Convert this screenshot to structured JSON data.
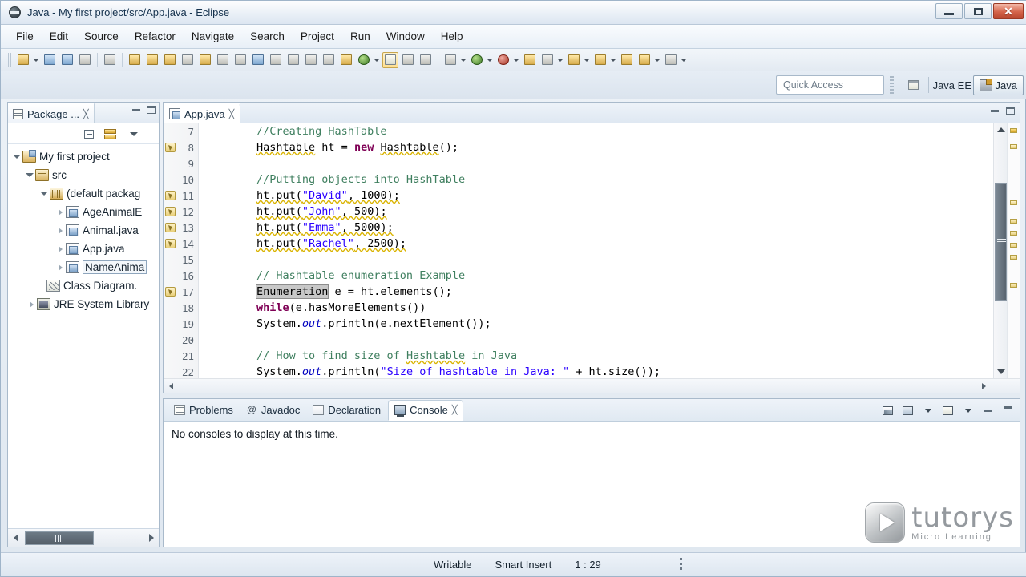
{
  "window": {
    "title": "Java - My first project/src/App.java - Eclipse",
    "app_icon": "eclipse-icon",
    "controls": [
      {
        "name": "minimize-button",
        "glyph": ""
      },
      {
        "name": "maximize-button",
        "glyph": ""
      },
      {
        "name": "close-button",
        "glyph": "✕"
      }
    ]
  },
  "menubar": {
    "items": [
      "File",
      "Edit",
      "Source",
      "Refactor",
      "Navigate",
      "Search",
      "Project",
      "Run",
      "Window",
      "Help"
    ]
  },
  "toolbar": {
    "icons": [
      "new-wizard-icon",
      "new-wizard-dropdown",
      "save-icon",
      "save-all-icon",
      "print-icon",
      "toggle-mark-occurrences-icon",
      "open-type-icon",
      "new-java-project-icon",
      "new-package-icon",
      "external-tools-icon",
      "search-icon",
      "last-edit-location-icon",
      "next-annotation-icon",
      "previous-annotation-icon",
      "back-icon",
      "forward-icon",
      "debug-icon",
      "run-icon",
      "coverage-icon",
      "open-perspective-icon",
      "refresh-icon",
      "toggle-breadcrumb-icon"
    ]
  },
  "quick_access": {
    "placeholder": "Quick Access",
    "new_perspective_icon": "open-perspective-icon",
    "perspectives": [
      {
        "label": "Java EE",
        "active": false
      },
      {
        "label": "Java",
        "active": true
      }
    ]
  },
  "package_explorer": {
    "tab_label": "Package ...",
    "tab_icon": "package-explorer-icon",
    "close_glyph": "╳",
    "toolbar_icons": [
      "collapse-all-icon",
      "link-with-editor-icon",
      "view-menu-icon"
    ],
    "view_buttons": [
      "minimize-view-button",
      "maximize-view-button"
    ],
    "tree": [
      {
        "label": "My first project",
        "indent": 0,
        "icon": "java-project-icon",
        "twisty": "open",
        "selected": false
      },
      {
        "label": "src",
        "indent": 1,
        "icon": "source-folder-icon",
        "twisty": "open",
        "selected": false
      },
      {
        "label": "(default packag",
        "indent": 2,
        "icon": "package-icon",
        "twisty": "open",
        "selected": false
      },
      {
        "label": "AgeAnimalE",
        "indent": 3,
        "icon": "java-file-icon",
        "twisty": "closed",
        "selected": false
      },
      {
        "label": "Animal.java",
        "indent": 3,
        "icon": "java-file-icon",
        "twisty": "closed",
        "selected": false
      },
      {
        "label": "App.java",
        "indent": 3,
        "icon": "java-file-icon",
        "twisty": "closed",
        "selected": false
      },
      {
        "label": "NameAnima",
        "indent": 3,
        "icon": "java-file-icon",
        "twisty": "closed",
        "selected": true
      },
      {
        "label": "Class Diagram.",
        "indent": 2,
        "icon": "class-diagram-icon",
        "twisty": "none",
        "selected": false
      },
      {
        "label": "JRE System Library",
        "indent": 1,
        "icon": "jre-library-icon",
        "twisty": "closed",
        "selected": false
      }
    ]
  },
  "editor": {
    "tab_label": "App.java",
    "tab_icon": "java-file-icon",
    "close_glyph": "╳",
    "view_buttons": [
      "minimize-editor-button",
      "maximize-editor-button"
    ],
    "first_line_number": 7,
    "lines": [
      {
        "num": 7,
        "warning": false,
        "text": "//Creating HashTable"
      },
      {
        "num": 8,
        "warning": true,
        "text": "Hashtable ht = new Hashtable();"
      },
      {
        "num": 9,
        "warning": false,
        "text": ""
      },
      {
        "num": 10,
        "warning": false,
        "text": "//Putting objects into HashTable"
      },
      {
        "num": 11,
        "warning": true,
        "text": "ht.put(\"David\", 1000);"
      },
      {
        "num": 12,
        "warning": true,
        "text": "ht.put(\"John\", 500);"
      },
      {
        "num": 13,
        "warning": true,
        "text": "ht.put(\"Emma\", 5000);"
      },
      {
        "num": 14,
        "warning": true,
        "text": "ht.put(\"Rachel\", 2500);"
      },
      {
        "num": 15,
        "warning": false,
        "text": ""
      },
      {
        "num": 16,
        "warning": false,
        "text": "// Hashtable enumeration Example"
      },
      {
        "num": 17,
        "warning": true,
        "text": "Enumeration e = ht.elements();"
      },
      {
        "num": 18,
        "warning": false,
        "text": "while(e.hasMoreElements())"
      },
      {
        "num": 19,
        "warning": false,
        "text": "System.out.println(e.nextElement());"
      },
      {
        "num": 20,
        "warning": false,
        "text": ""
      },
      {
        "num": 21,
        "warning": false,
        "text": "// How to find size of Hashtable in Java"
      },
      {
        "num": 22,
        "warning": false,
        "text": "System.out.println(\"Size of hashtable in Java: \" + ht.size());"
      }
    ],
    "selection": "Enumeration",
    "colors": {
      "comment": "#3f7f5f",
      "keyword": "#7f0055",
      "string": "#2a00ff",
      "field": "#0000c0",
      "selection_bg": "#c8c8c8",
      "warning_underline": "#d9b300"
    }
  },
  "console_panel": {
    "tabs": [
      {
        "label": "Problems",
        "icon": "problems-icon",
        "active": false
      },
      {
        "label": "Javadoc",
        "icon": "javadoc-icon",
        "active": false
      },
      {
        "label": "Declaration",
        "icon": "declaration-icon",
        "active": false
      },
      {
        "label": "Console",
        "icon": "console-icon",
        "active": true
      }
    ],
    "close_glyph": "╳",
    "message": "No consoles to display at this time.",
    "toolbar_icons": [
      "open-console-icon",
      "display-selected-console-icon",
      "display-console-dropdown",
      "new-console-view-icon",
      "new-console-dropdown",
      "minimize-view-button",
      "maximize-view-button"
    ]
  },
  "watermark": {
    "name": "tutorys",
    "tagline": "Micro Learning",
    "icon": "play-button-icon"
  },
  "statusbar": {
    "writable": "Writable",
    "insert_mode": "Smart Insert",
    "position": "1 : 29"
  }
}
